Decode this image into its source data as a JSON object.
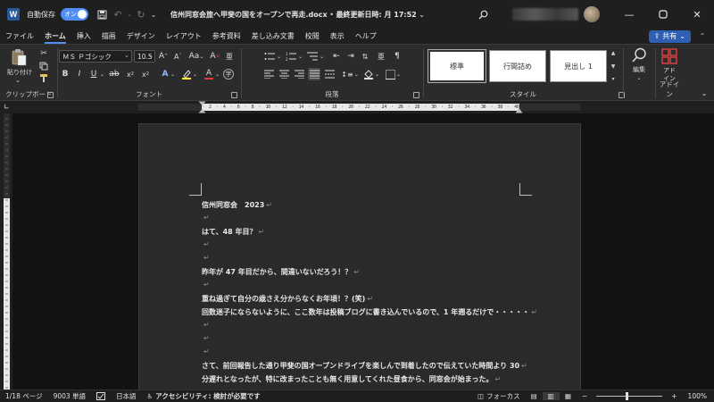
{
  "titlebar": {
    "logo": "W",
    "autosave_label": "自動保存",
    "autosave_state": "オン",
    "file_title": "信州同窓会旅へ甲斐の国をオープンで再走.docx",
    "separator": "•",
    "last_saved": "最終更新日時: 月 17:52",
    "icons": [
      "save-icon",
      "undo-icon",
      "redo-icon",
      "search-icon",
      "minimize-icon",
      "restore-icon",
      "close-icon"
    ]
  },
  "menu": {
    "items": [
      "ファイル",
      "ホーム",
      "挿入",
      "描画",
      "デザイン",
      "レイアウト",
      "参考資料",
      "差し込み文書",
      "校閲",
      "表示",
      "ヘルプ"
    ],
    "active": "ホーム",
    "share": "共有"
  },
  "ribbon": {
    "clipboard": {
      "paste": "貼り付け",
      "label": "クリップボード"
    },
    "font": {
      "name": "ＭＳ Ｐゴシック",
      "size": "10.5",
      "label": "フォント",
      "aa": "Aa"
    },
    "paragraph": {
      "label": "段落"
    },
    "styles": {
      "items": [
        "標準",
        "行間詰め",
        "見出し 1"
      ],
      "label": "スタイル"
    },
    "editing": {
      "label": "編集"
    },
    "addin": {
      "label1": "アド",
      "label2": "イン",
      "group": "アドイン"
    }
  },
  "document": {
    "lines": [
      {
        "text": "信州同窓会　2023",
        "para": false
      },
      {
        "text": "",
        "para": true
      },
      {
        "text": "はて、48 年目？",
        "para": false
      },
      {
        "text": "",
        "para": true
      },
      {
        "text": "",
        "para": true
      },
      {
        "text": "昨年が 47 年目だから、間違いないだろう！？",
        "para": false
      },
      {
        "text": "",
        "para": true
      },
      {
        "text": "重ね過ぎて自分の歳さえ分からなくお年頃！？(笑)",
        "para": false
      },
      {
        "text": "回数迷子にならないように、ここ数年は投稿ブログに書き込んでいるので、1 年遡るだけで・・・・・",
        "para": false
      },
      {
        "text": "",
        "para": true
      },
      {
        "text": "",
        "para": true
      },
      {
        "text": "",
        "para": true
      },
      {
        "text": "さて、前回報告した通り甲斐の国オープンドライブを楽しんで到着したので伝えていた時間より 30",
        "para": false
      },
      {
        "text": "分遅れとなったが、特に改まったことも無く用意してくれた昼食から、同窓会が始まった。",
        "para": false
      }
    ],
    "pilcrow": "↵"
  },
  "status": {
    "page": "1/18 ページ",
    "words": "9003 単語",
    "language": "日本語",
    "accessibility": "アクセシビリティ: 検討が必要です",
    "focus": "フォーカス",
    "zoom": "100%",
    "zoom_fraction": 0.45
  }
}
